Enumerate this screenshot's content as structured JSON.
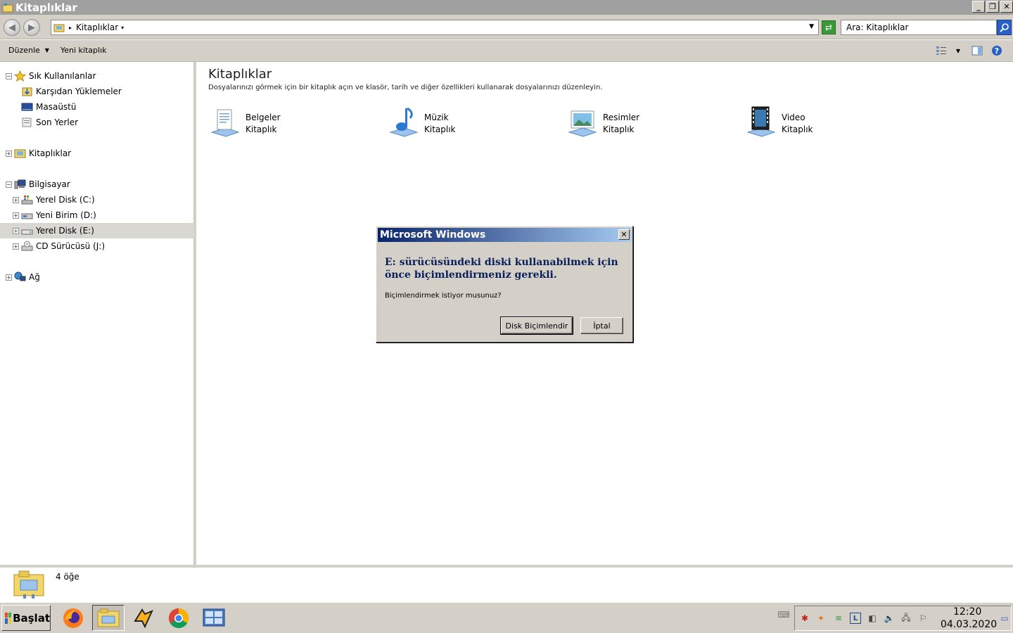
{
  "window": {
    "title": "Kitaplıklar"
  },
  "address": {
    "crumb": "Kitaplıklar",
    "search_placeholder": "Ara: Kitaplıklar"
  },
  "toolbar": {
    "organize": "Düzenle",
    "new_library": "Yeni kitaplık"
  },
  "nav": {
    "favorites": "Sık Kullanılanlar",
    "downloads": "Karşıdan Yüklemeler",
    "desktop": "Masaüstü",
    "recent": "Son Yerler",
    "libraries": "Kitaplıklar",
    "computer": "Bilgisayar",
    "drive_c": "Yerel Disk (C:)",
    "drive_d": "Yeni Birim (D:)",
    "drive_e": "Yerel Disk (E:)",
    "drive_j": "CD Sürücüsü (J:)",
    "network": "Ağ"
  },
  "content": {
    "heading": "Kitaplıklar",
    "description": "Dosyalarınızı görmek için bir kitaplık açın ve klasör, tarih ve diğer özellikleri kullanarak dosyalarınızı düzenleyin.",
    "libraries": [
      {
        "name": "Belgeler",
        "type": "Kitaplık"
      },
      {
        "name": "Müzik",
        "type": "Kitaplık"
      },
      {
        "name": "Resimler",
        "type": "Kitaplık"
      },
      {
        "name": "Video",
        "type": "Kitaplık"
      }
    ]
  },
  "details": {
    "count": "4 öğe"
  },
  "dialog": {
    "title": "Microsoft Windows",
    "message": "E: sürücüsündeki diski kullanabilmek için önce biçimlendirmeniz gerekli.",
    "question": "Biçimlendirmek istiyor musunuz?",
    "format_button": "Disk Biçimlendir",
    "cancel_button": "İptal"
  },
  "taskbar": {
    "start": "Başlat",
    "time": "12:20",
    "date": "04.03.2020"
  },
  "colors": {
    "dialog_title_start": "#0a246a",
    "dialog_title_end": "#a6caf0",
    "face": "#d4d0c8"
  }
}
